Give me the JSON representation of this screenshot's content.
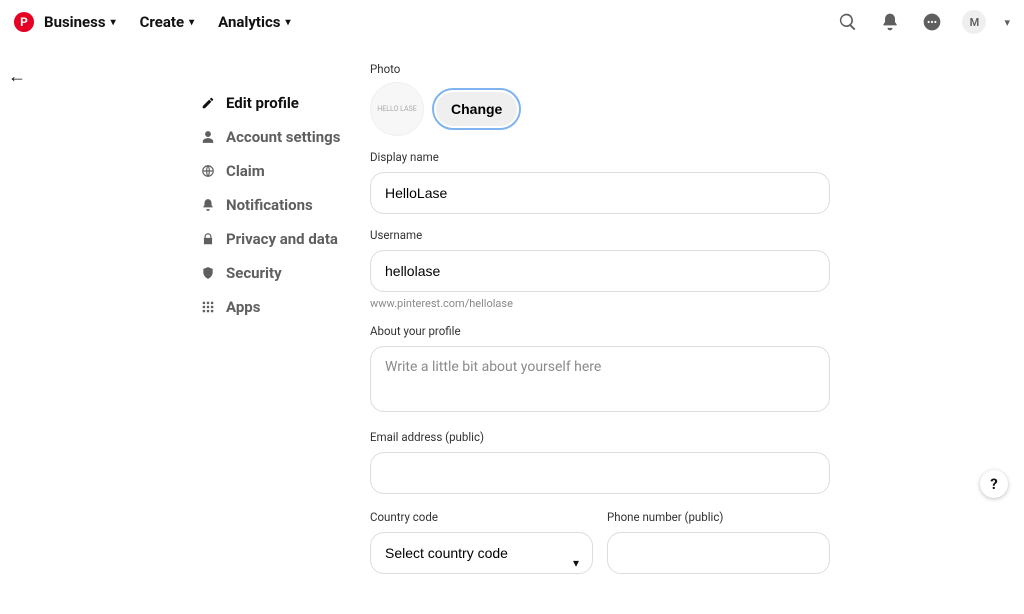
{
  "nav": {
    "items": [
      "Business",
      "Create",
      "Analytics"
    ],
    "avatar_initial": "M"
  },
  "sidebar": {
    "items": [
      {
        "label": "Edit profile"
      },
      {
        "label": "Account settings"
      },
      {
        "label": "Claim"
      },
      {
        "label": "Notifications"
      },
      {
        "label": "Privacy and data"
      },
      {
        "label": "Security"
      },
      {
        "label": "Apps"
      }
    ]
  },
  "form": {
    "photo_label": "Photo",
    "photo_thumb_text": "HELLO LASE",
    "change_btn": "Change",
    "display_name_label": "Display name",
    "display_name_value": "HelloLase",
    "username_label": "Username",
    "username_value": "hellolase",
    "username_hint": "www.pinterest.com/hellolase",
    "about_label": "About your profile",
    "about_placeholder": "Write a little bit about yourself here",
    "email_label": "Email address (public)",
    "country_label": "Country code",
    "country_placeholder": "Select country code",
    "phone_label": "Phone number (public)"
  },
  "help": "?"
}
